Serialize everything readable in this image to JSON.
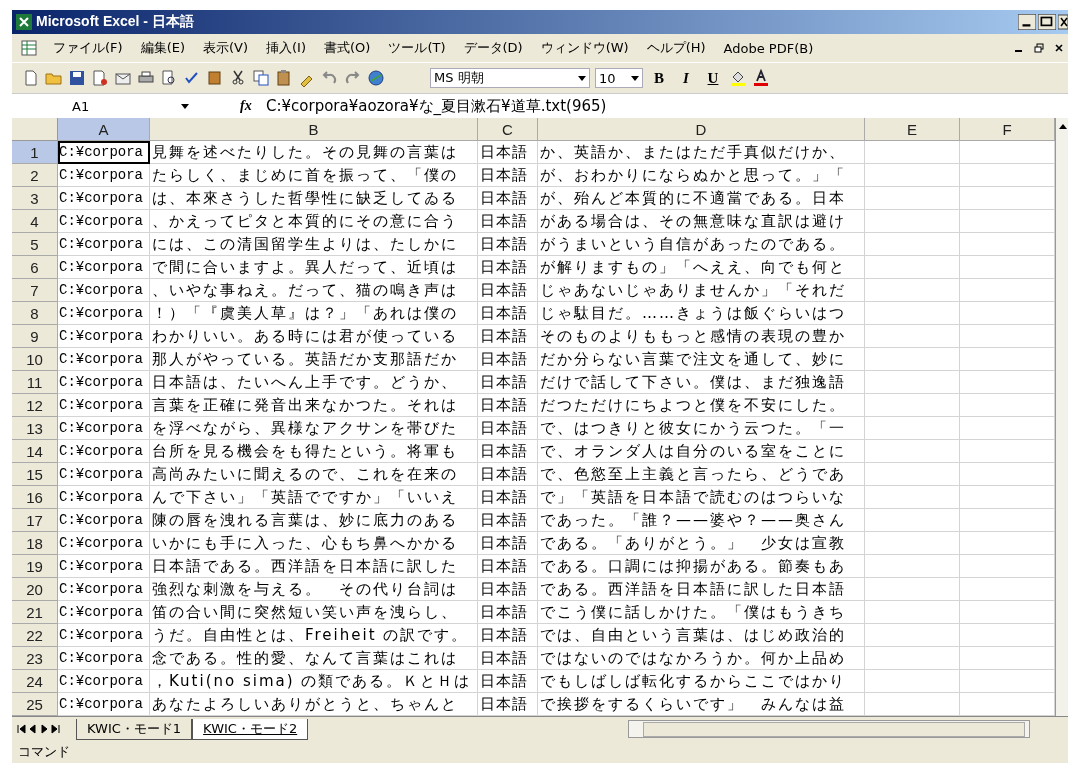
{
  "window": {
    "title": "Microsoft Excel - 日本語"
  },
  "menu": [
    "ファイル(F)",
    "編集(E)",
    "表示(V)",
    "挿入(I)",
    "書式(O)",
    "ツール(T)",
    "データ(D)",
    "ウィンドウ(W)",
    "ヘルプ(H)",
    "Adobe PDF(B)"
  ],
  "toolbar": {
    "font": "MS 明朝",
    "size": "10",
    "bold": "B",
    "italic": "I",
    "underline": "U"
  },
  "formula_bar": {
    "name_box": "A1",
    "fx": "fx",
    "value": "C:¥corpora¥aozora¥な_夏目漱石¥道草.txt(965)"
  },
  "columns": [
    {
      "label": "A",
      "selected": true
    },
    {
      "label": "B",
      "selected": false
    },
    {
      "label": "C",
      "selected": false
    },
    {
      "label": "D",
      "selected": false
    },
    {
      "label": "E",
      "selected": false
    },
    {
      "label": "F",
      "selected": false
    }
  ],
  "rows": [
    {
      "number": "1",
      "selected": true,
      "cells": [
        "C:¥corpora",
        "見舞を述べたりした。その見舞の言葉は",
        "日本語",
        "か、英語か、またはただ手真似だけか、"
      ]
    },
    {
      "number": "2",
      "selected": false,
      "cells": [
        "C:¥corpora",
        "たらしく、まじめに首を振って、「僕の",
        "日本語",
        "が、おわかりにならぬかと思って。」「"
      ]
    },
    {
      "number": "3",
      "selected": false,
      "cells": [
        "C:¥corpora",
        "は、本來さうした哲學性に缺乏してゐる",
        "日本語",
        "が、殆んど本質的に不適當である。日本"
      ]
    },
    {
      "number": "4",
      "selected": false,
      "cells": [
        "C:¥corpora",
        "、かえってピタと本質的にその意に合う",
        "日本語",
        "がある場合は、その無意味な直訳は避け"
      ]
    },
    {
      "number": "5",
      "selected": false,
      "cells": [
        "C:¥corpora",
        "には、この清国留学生よりは、たしかに",
        "日本語",
        "がうまいという自信があったのである。"
      ]
    },
    {
      "number": "6",
      "selected": false,
      "cells": [
        "C:¥corpora",
        "で間に合いますよ。異人だって、近頃は",
        "日本語",
        "が解りますもの」「へええ、向でも何と"
      ]
    },
    {
      "number": "7",
      "selected": false,
      "cells": [
        "C:¥corpora",
        "、いやな事ねえ。だって、猫の鳴き声は",
        "日本語",
        "じゃあないじゃありませんか」「それだ"
      ]
    },
    {
      "number": "8",
      "selected": false,
      "cells": [
        "C:¥corpora",
        "！）「『虞美人草』は？」「あれは僕の",
        "日本語",
        "じゃ駄目だ。……きょうは飯ぐらいはつ"
      ]
    },
    {
      "number": "9",
      "selected": false,
      "cells": [
        "C:¥corpora",
        "わかりいい。ある時には君が使っている",
        "日本語",
        "そのものよりももっと感情の表現の豊か"
      ]
    },
    {
      "number": "10",
      "selected": false,
      "cells": [
        "C:¥corpora",
        "那人がやっている。英語だか支那語だか",
        "日本語",
        "だか分らない言葉で注文を通して、妙に"
      ]
    },
    {
      "number": "11",
      "selected": false,
      "cells": [
        "C:¥corpora",
        "日本語は、たいへん上手です。どうか、",
        "日本語",
        "だけで話して下さい。僕は、まだ独逸語"
      ]
    },
    {
      "number": "12",
      "selected": false,
      "cells": [
        "C:¥corpora",
        "言葉を正確に発音出来なかつた。それは",
        "日本語",
        "だつただけにちよつと僕を不安にした。"
      ]
    },
    {
      "number": "13",
      "selected": false,
      "cells": [
        "C:¥corpora",
        "を浮べながら、異様なアクサンを帯びた",
        "日本語",
        "で、はつきりと彼女にかう云つた。「一"
      ]
    },
    {
      "number": "14",
      "selected": false,
      "cells": [
        "C:¥corpora",
        "台所を見る機会をも得たという。将軍も",
        "日本語",
        "で、オランダ人は自分のいる室をことに"
      ]
    },
    {
      "number": "15",
      "selected": false,
      "cells": [
        "C:¥corpora",
        "高尚みたいに聞えるので、これを在来の",
        "日本語",
        "で、色慾至上主義と言ったら、どうであ"
      ]
    },
    {
      "number": "16",
      "selected": false,
      "cells": [
        "C:¥corpora",
        "んで下さい」「英語でですか」「いいえ",
        "日本語",
        "で」「英語を日本語で読むのはつらいな"
      ]
    },
    {
      "number": "17",
      "selected": false,
      "cells": [
        "C:¥corpora",
        "陳の唇を洩れる言葉は、妙に底力のある",
        "日本語",
        "であった。「誰？——婆や？——奥さん"
      ]
    },
    {
      "number": "18",
      "selected": false,
      "cells": [
        "C:¥corpora",
        "いかにも手に入った、心もち鼻へかかる",
        "日本語",
        "である。「ありがとう。」　少女は宣教"
      ]
    },
    {
      "number": "19",
      "selected": false,
      "cells": [
        "C:¥corpora",
        "日本語である。西洋語を日本語に訳した",
        "日本語",
        "である。口調には抑揚がある。節奏もあ"
      ]
    },
    {
      "number": "20",
      "selected": false,
      "cells": [
        "C:¥corpora",
        "強烈な刺激を与える。　その代り台詞は",
        "日本語",
        "である。西洋語を日本語に訳した日本語"
      ]
    },
    {
      "number": "21",
      "selected": false,
      "cells": [
        "C:¥corpora",
        "笛の合い間に突然短い笑い声を洩らし、",
        "日本語",
        "でこう僕に話しかけた。「僕はもうきち"
      ]
    },
    {
      "number": "22",
      "selected": false,
      "cells": [
        "C:¥corpora",
        "うだ。自由性とは、Freiheit の訳です。",
        "日本語",
        "では、自由という言葉は、はじめ政治的"
      ]
    },
    {
      "number": "23",
      "selected": false,
      "cells": [
        "C:¥corpora",
        "念である。性的愛、なんて言葉はこれは",
        "日本語",
        "ではないのではなかろうか。何か上品め"
      ]
    },
    {
      "number": "24",
      "selected": false,
      "cells": [
        "C:¥corpora",
        "，Kuti(no sima) の類である。ＫとＨは",
        "日本語",
        "でもしばしば転化するからここではかり"
      ]
    },
    {
      "number": "25",
      "selected": false,
      "cells": [
        "C:¥corpora",
        "あなたよろしいありがとうと、ちゃんと",
        "日本語",
        "で挨拶をするくらいです」　みんなは益"
      ]
    }
  ],
  "sheet_tabs": [
    {
      "label": "KWIC・モード1",
      "selected": false
    },
    {
      "label": "KWIC・モード2",
      "selected": true
    }
  ],
  "status_bar": "コマンド"
}
